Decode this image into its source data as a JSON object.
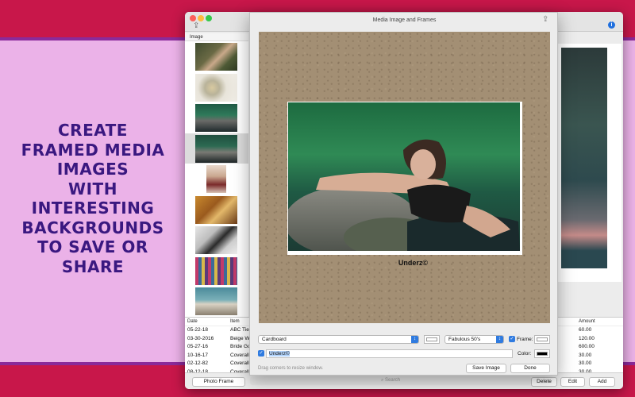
{
  "promo": {
    "lines": [
      "CREATE",
      "FRAMED MEDIA",
      "IMAGES",
      "WITH",
      "INTERESTING",
      "BACKGROUNDS",
      "TO SAVE OR",
      "SHARE"
    ]
  },
  "main_window": {
    "image_column_header": "Image",
    "thumbnails": [
      {
        "name": "thumb-woman-field",
        "selected": false
      },
      {
        "name": "thumb-flowers",
        "selected": false
      },
      {
        "name": "thumb-woman-rock",
        "selected": false
      },
      {
        "name": "thumb-woman-rock-selected",
        "selected": true
      },
      {
        "name": "thumb-woman-standing",
        "selected": false
      },
      {
        "name": "thumb-leather-bag",
        "selected": false
      },
      {
        "name": "thumb-desk-items",
        "selected": false
      },
      {
        "name": "thumb-clothing-rack",
        "selected": false
      },
      {
        "name": "thumb-vintage-car",
        "selected": false
      }
    ],
    "table": {
      "headers": {
        "date": "Date",
        "item": "Item",
        "amount": "Amount"
      },
      "rows": [
        {
          "date": "05-22-18",
          "item": "ABC Tie",
          "amount": "60.00"
        },
        {
          "date": "03-30-2016",
          "item": "Beige W",
          "amount": "120.00"
        },
        {
          "date": "05-27-16",
          "item": "Bride Go",
          "amount": "600.00"
        },
        {
          "date": "10-16-17",
          "item": "Coverall",
          "amount": "30.00"
        },
        {
          "date": "02-12-82",
          "item": "Coverall",
          "amount": "30.00"
        },
        {
          "date": "08-12-18",
          "item": "Coverall",
          "amount": "30.00"
        }
      ]
    },
    "buttons": {
      "photo_frame": "Photo Frame",
      "search_placeholder": "Search",
      "delete": "Delete",
      "edit": "Edit",
      "add": "Add"
    }
  },
  "dialog": {
    "title": "Media Image and Frames",
    "caption": "Underz©",
    "background_popup": "Cardboard",
    "frame_style_popup": "Fabulous 50's",
    "frame_label": "Frame:",
    "frame_checked": true,
    "caption_checked": true,
    "caption_field_value": "Underz©",
    "color_label": "Color:",
    "hint": "Drag corners to resize window.",
    "save_button": "Save Image",
    "done_button": "Done"
  },
  "colors": {
    "accent": "#2f7be0",
    "promo_text": "#3a1880",
    "promo_background": "#ebb2e8",
    "band_red": "#c8174a"
  }
}
